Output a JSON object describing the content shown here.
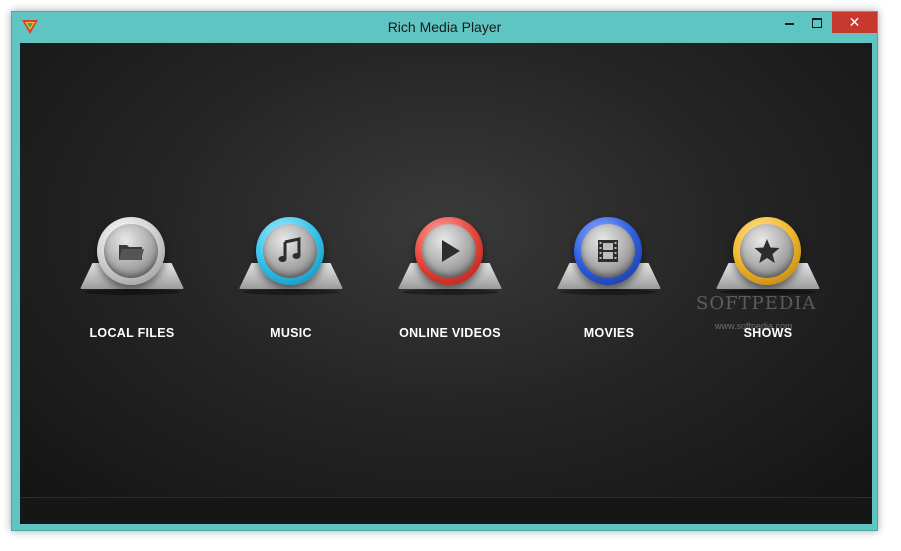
{
  "window": {
    "title": "Rich Media Player",
    "close_label": "✕"
  },
  "menu": [
    {
      "label": "LOCAL FILES",
      "ring_color": "#d8d8d8",
      "icon": "folder-icon"
    },
    {
      "label": "MUSIC",
      "ring_color": "#35c4ec",
      "icon": "music-note-icon"
    },
    {
      "label": "ONLINE VIDEOS",
      "ring_color": "#e8463b",
      "icon": "play-icon"
    },
    {
      "label": "MOVIES",
      "ring_color": "#2f5fe0",
      "icon": "film-icon"
    },
    {
      "label": "SHOWS",
      "ring_color": "#f2b62a",
      "icon": "star-icon"
    }
  ],
  "watermark": {
    "brand": "SOFTPEDIA",
    "url": "www.softpedia.com"
  }
}
